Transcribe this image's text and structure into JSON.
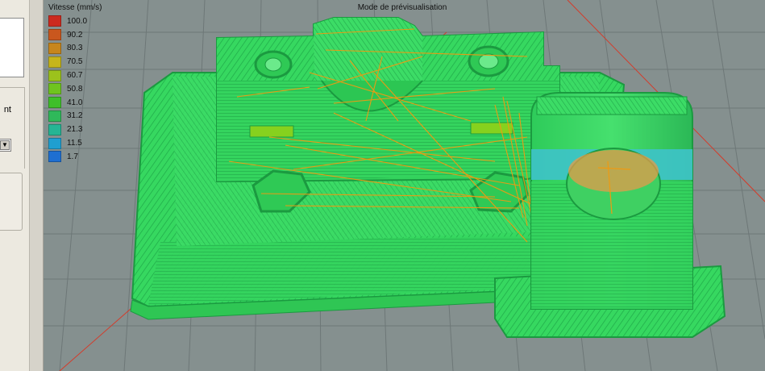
{
  "left_panel": {
    "label_fragment": "nt",
    "select_arrow": "chevron-down-icon"
  },
  "viewport": {
    "title": "Mode de prévisualisation",
    "legend": {
      "title": "Vitesse (mm/s)",
      "items": [
        {
          "label": "100.0",
          "color": "#cc2a1f"
        },
        {
          "label": "90.2",
          "color": "#c9571e"
        },
        {
          "label": "80.3",
          "color": "#c7861c"
        },
        {
          "label": "70.5",
          "color": "#c6b51b"
        },
        {
          "label": "60.7",
          "color": "#9cc21c"
        },
        {
          "label": "50.8",
          "color": "#6fc41f"
        },
        {
          "label": "41.0",
          "color": "#3fbf2a"
        },
        {
          "label": "31.2",
          "color": "#2fb95a"
        },
        {
          "label": "21.3",
          "color": "#25b594"
        },
        {
          "label": "11.5",
          "color": "#1f9fd0"
        },
        {
          "label": "1.7",
          "color": "#1f6fd1"
        }
      ]
    }
  }
}
